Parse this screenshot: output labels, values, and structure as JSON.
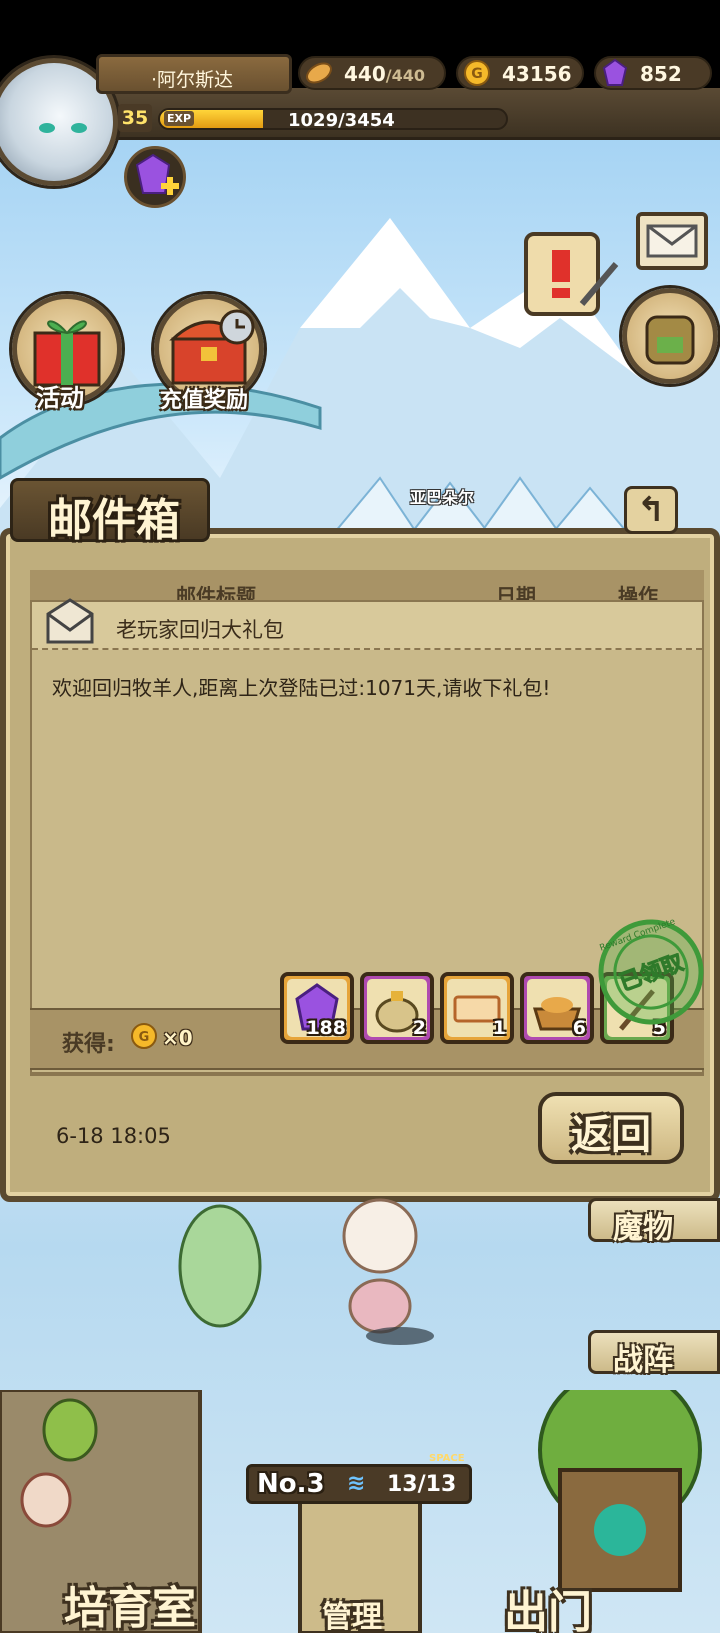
{
  "hud": {
    "player_name": "·阿尔斯达",
    "level": "35",
    "exp_label": "EXP",
    "exp_text": "1029/3454",
    "exp_fraction": 0.298,
    "bread": "440",
    "bread_max": "/440",
    "gold": "43156",
    "gems": "852"
  },
  "buttons": {
    "activity": "活动",
    "recharge_reward": "充值奖励"
  },
  "npc_name": "亚巴朵尔",
  "mailbox": {
    "title": "邮件箱",
    "columns": {
      "subject": "邮件标题",
      "date": "日期",
      "action": "操作"
    },
    "mail": {
      "subject": "老玩家回归大礼包",
      "message": "欢迎回归牧羊人,距离上次登陆已过:1071天,请收下礼包!",
      "date": "6-18 18:05",
      "obtain_label": "获得:",
      "coin_count": "×0",
      "rewards": [
        {
          "icon": "purple-gem-icon",
          "count": "188",
          "frame": "#e6a43a"
        },
        {
          "icon": "treasure-bag-icon",
          "count": "2",
          "frame": "#b04ab0"
        },
        {
          "icon": "ticket-icon",
          "count": "1",
          "frame": "#e6a43a"
        },
        {
          "icon": "bread-basket-icon",
          "count": "6",
          "frame": "#b04ab0"
        },
        {
          "icon": "feather-icon",
          "count": "5",
          "frame": "#6aa84f"
        }
      ],
      "stamp_text": "已领取",
      "stamp_ring_text": "Reward Complete"
    },
    "return_label": "返回"
  },
  "side_tabs": {
    "monster": "魔物",
    "formation": "战阵"
  },
  "room": {
    "no_label": "No.",
    "no_value": "3",
    "capacity": "13/13",
    "space_label": "SPACE"
  },
  "bottom_nav": {
    "nursery": "培育室",
    "manage": "管理",
    "go_out": "出门"
  }
}
